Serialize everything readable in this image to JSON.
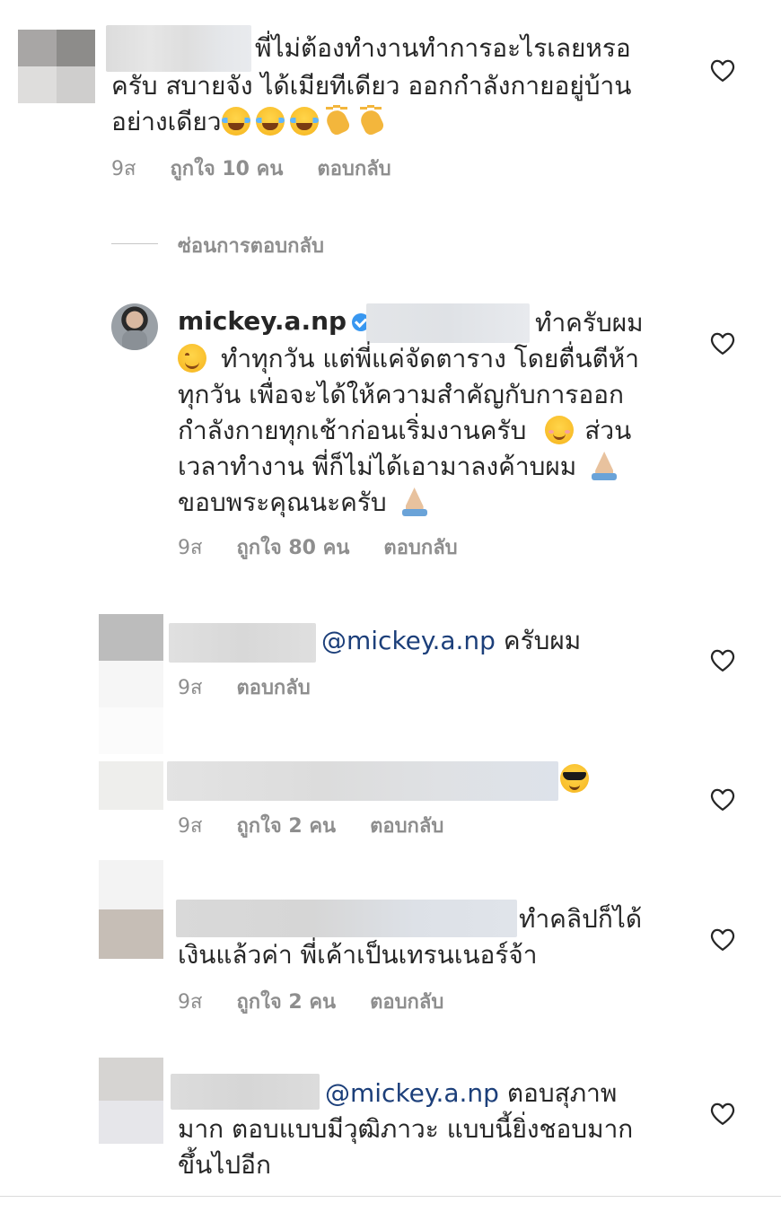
{
  "meta": {
    "time": "9ส",
    "reply_label": "ตอบกลับ",
    "hide_replies_label": "ซ่อนการตอบกลับ"
  },
  "comments": [
    {
      "text_line1": "พี่ไม่ต้องทำงานทำการอะไรเลยหรอ",
      "text_line2": "ครับ สบายจัง ได้เมียทีเดียว ออกกำลังกายอยู่บ้าน",
      "text_line3": "อย่างเดียว",
      "likes": "ถูกใจ 10 คน"
    },
    {
      "username": "mickey.a.np",
      "text_line1": "ทำครับผม",
      "text_line2": "ทำทุกวัน แต่พี่แค่จัดตาราง โดยตื่นตีห้า",
      "text_line3": "ทุกวัน เพื่อจะได้ให้ความสำคัญกับการออก",
      "text_line4a": "กำลังกายทุกเช้าก่อนเริ่มงานครับ",
      "text_line4b": "ส่วน",
      "text_line5": "เวลาทำงาน พี่ก็ไม่ได้เอามาลงค้าบผม",
      "text_line6": "ขอบพระคุณนะครับ",
      "likes": "ถูกใจ 80 คน"
    },
    {
      "mention": "@mickey.a.np",
      "text": "ครับผม"
    },
    {
      "likes": "ถูกใจ 2 คน"
    },
    {
      "text_line1": "ทำคลิปก็ได้",
      "text_line2": "เงินแล้วค่า พี่เค้าเป็นเทรนเนอร์จ้า",
      "likes": "ถูกใจ 2 คน"
    },
    {
      "mention": "@mickey.a.np",
      "text_line1": "ตอบสุภาพ",
      "text_line2": "มาก ตอบแบบมีวุฒิภาวะ แบบนี้ยิ่งชอบมาก",
      "text_line3": "ขึ้นไปอีก"
    }
  ],
  "icons": {
    "heart": "heart-outline-icon",
    "verified": "verified-badge-icon"
  },
  "colors": {
    "text": "#262626",
    "meta": "#8e8e8e",
    "mention": "#1c3f7a",
    "verified": "#3897f0"
  }
}
